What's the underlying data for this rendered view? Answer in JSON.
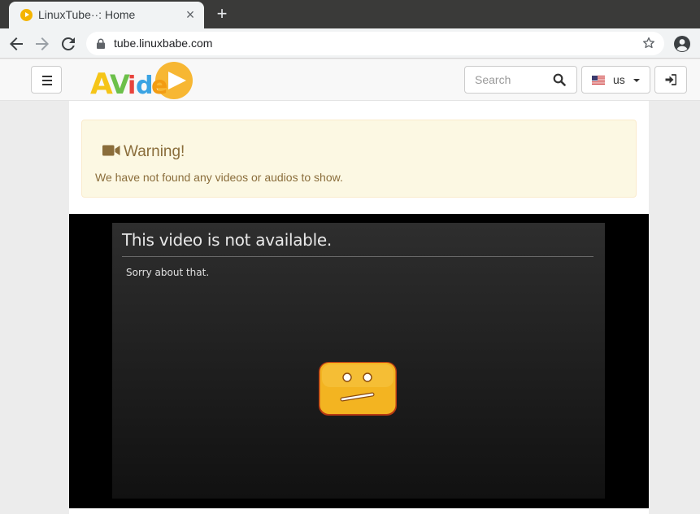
{
  "browser": {
    "tab_title": "LinuxTube··: Home",
    "tab_close": "×",
    "new_tab": "+",
    "url": "tube.linuxbabe.com"
  },
  "header": {
    "logo_text": "AVideo",
    "search_placeholder": "Search",
    "language": "us"
  },
  "alert": {
    "title": "Warning!",
    "message": "We have not found any videos or audios to show."
  },
  "player": {
    "title": "This video is not  available.",
    "subtitle": "Sorry about that."
  },
  "colors": {
    "alert_bg": "#fcf8e3",
    "alert_text": "#8a6d3b",
    "logo_yellow": "#f5c518",
    "logo_orange": "#f7a823",
    "sad_face": "#f3b421"
  }
}
